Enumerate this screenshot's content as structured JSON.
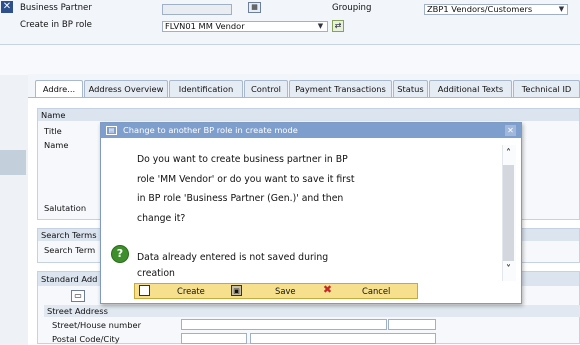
{
  "header": {
    "business_partner_label": "Business Partner",
    "create_in_role_label": "Create in BP role",
    "bp_role_value": "FLVN01 MM Vendor",
    "grouping_label": "Grouping",
    "grouping_value": "ZBP1 Vendors/Customers"
  },
  "tabs": [
    {
      "label": "Addre..."
    },
    {
      "label": "Address Overview"
    },
    {
      "label": "Identification"
    },
    {
      "label": "Control"
    },
    {
      "label": "Payment Transactions"
    },
    {
      "label": "Status"
    },
    {
      "label": "Additional Texts"
    },
    {
      "label": "Technical ID"
    }
  ],
  "form": {
    "name_group": "Name",
    "title_label": "Title",
    "name_label": "Name",
    "salutation_label": "Salutation",
    "search_terms_group": "Search Terms",
    "search_term_label": "Search Term",
    "standard_address_group": "Standard Add",
    "street_address_group": "Street Address",
    "street_house_label": "Street/House number",
    "postal_city_label": "Postal Code/City"
  },
  "dialog": {
    "title": "Change to another BP role in create mode",
    "message_lines": [
      "Do you want to create business partner in BP",
      "role 'MM Vendor' or do you want to save it first",
      "in BP role 'Business Partner (Gen.)' and then",
      "change it?",
      "",
      "Data already entered is not saved during",
      "creation"
    ],
    "buttons": {
      "create": "Create",
      "save": "Save",
      "cancel": "Cancel"
    }
  },
  "colors": {
    "dialog_title_bg": "#7e9fcd",
    "button_bar_bg": "#f6e08d",
    "help_icon": "#3e8f2b",
    "cancel_icon": "#c62828"
  }
}
